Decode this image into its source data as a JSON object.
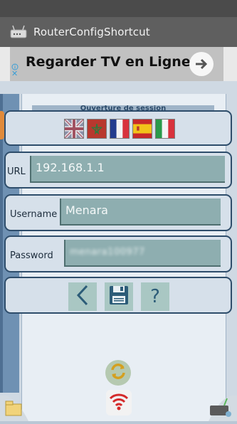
{
  "app": {
    "title": "RouterConfigShortcut",
    "icon": "router-icon"
  },
  "ad": {
    "text": "Regarder TV en Ligne",
    "arrow_icon": "arrow-right-icon",
    "close_label": "✕"
  },
  "paper": {
    "header": "Ouverture de session"
  },
  "languages": [
    {
      "name": "flag-uk-icon"
    },
    {
      "name": "flag-morocco-icon"
    },
    {
      "name": "flag-france-icon"
    },
    {
      "name": "flag-spain-icon"
    },
    {
      "name": "flag-italy-icon"
    }
  ],
  "form": {
    "url_label": "URL",
    "url_value": "192.168.1.1",
    "username_label": "Username",
    "username_value": "Menara",
    "password_label": "Password",
    "password_value": "menara100977"
  },
  "actions": [
    "back-icon",
    "save-icon",
    "help-icon"
  ],
  "help_glyph": "?",
  "colors": {
    "field": "#8eaeb0",
    "card_border": "#2e4d6b",
    "appbar": "#5f5f5f"
  }
}
